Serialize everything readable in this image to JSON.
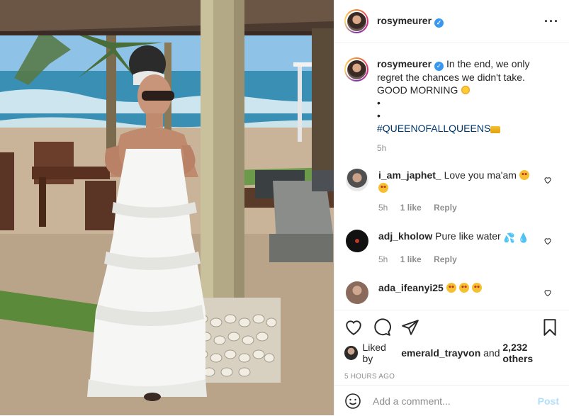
{
  "post": {
    "author": "rosymeurer",
    "more_icon": "more-horizontal-icon",
    "caption": {
      "username": "rosymeurer",
      "text": "In the end, we only regret the chances we didn't take. GOOD MORNING",
      "bullet1": "•",
      "bullet2": "•",
      "hashtag": "#QUEENOFALLQUEENS",
      "time": "5h"
    },
    "comments": [
      {
        "username": "i_am_japhet_",
        "text": "Love you ma'am",
        "time": "5h",
        "likes": "1 like",
        "reply": "Reply",
        "avatar_color": "#6d6d6d"
      },
      {
        "username": "adj_kholow",
        "text": "Pure like water",
        "time": "5h",
        "likes": "1 like",
        "reply": "Reply",
        "avatar_color": "#111111"
      },
      {
        "username": "ada_ifeanyi25",
        "text": "",
        "avatar_color": "#b08a78"
      }
    ],
    "likes": {
      "prefix": "Liked by",
      "user": "emerald_trayvon",
      "middle": "and",
      "count": "2,232 others"
    },
    "timestamp": "5 HOURS AGO",
    "add_comment": {
      "placeholder": "Add a comment...",
      "post_label": "Post"
    }
  },
  "colors": {
    "link": "#00376b",
    "verified": "#3897f0",
    "muted": "#8e8e8e",
    "post_disabled": "#b2dffc"
  }
}
